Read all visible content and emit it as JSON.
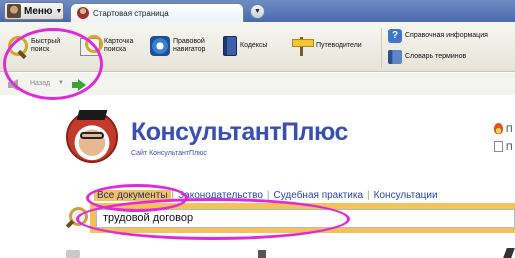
{
  "topbar": {
    "menu_label": "Меню",
    "tab_title": "Стартовая страница"
  },
  "ribbon": {
    "quick_search": "Быстрый\nпоиск",
    "search_card": "Карточка\nпоиска",
    "legal_navigator": "Правовой\nнавигатор",
    "codes": "Кодексы",
    "guides": "Путеводители",
    "reference_info": "Справочная информация",
    "terms_dictionary": "Словарь терминов"
  },
  "nav": {
    "back_label": "Назад"
  },
  "brand": {
    "name": "КонсультантПлюс",
    "subtitle": "Сайт КонсультантПлюс",
    "right_link_1": "П",
    "right_link_2": "П"
  },
  "search": {
    "tabs": [
      {
        "label": "Все документы",
        "active": true
      },
      {
        "label": "Законодательство",
        "active": false
      },
      {
        "label": "Судебная практика",
        "active": false
      },
      {
        "label": "Консультации",
        "active": false
      }
    ],
    "query": "трудовой договор"
  },
  "colors": {
    "brand_blue": "#3a4fb0",
    "search_accent": "#f4c15a",
    "annotation_magenta": "#e02ad8"
  }
}
